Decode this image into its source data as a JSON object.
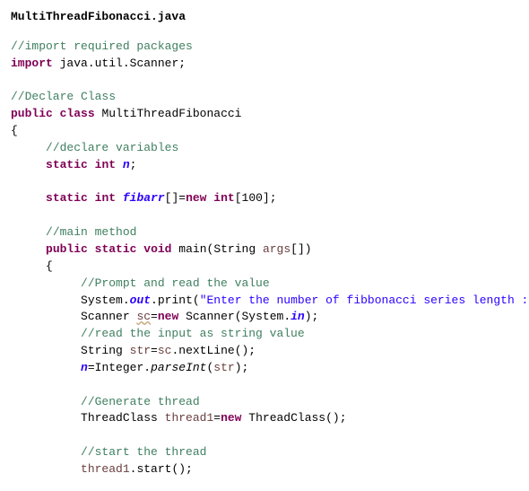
{
  "file": {
    "name": "MultiThreadFibonacci.java"
  },
  "c": {
    "imp_pkg": "//import required packages",
    "decl_class": "//Declare Class",
    "decl_vars": "//declare variables",
    "main_m": "//main method",
    "prompt": "//Prompt and read the value",
    "read_input": "//read the input as string value",
    "gen_thread": "//Generate thread",
    "start_thread": "//start the thread"
  },
  "kw": {
    "import": "import",
    "public": "public",
    "class": "class",
    "static": "static",
    "int": "int",
    "void": "void",
    "new": "new"
  },
  "id": {
    "scanner_pkg": "java.util.Scanner",
    "className": "MultiThreadFibonacci",
    "nVar": "n",
    "fibarr": "fibarr",
    "arrSize": "100",
    "main": "main",
    "argsType": "String",
    "args": "args",
    "System": "System",
    "out": "out",
    "print": "print",
    "Scanner": "Scanner",
    "sc": "sc",
    "in": "in",
    "str": "str",
    "nextLine": "nextLine",
    "Integer": "Integer",
    "parseInt": "parseInt",
    "ThreadClass": "ThreadClass",
    "thread1": "thread1",
    "start": "start"
  },
  "str": {
    "prompt": "\"Enter the number of fibbonacci series length :\""
  }
}
